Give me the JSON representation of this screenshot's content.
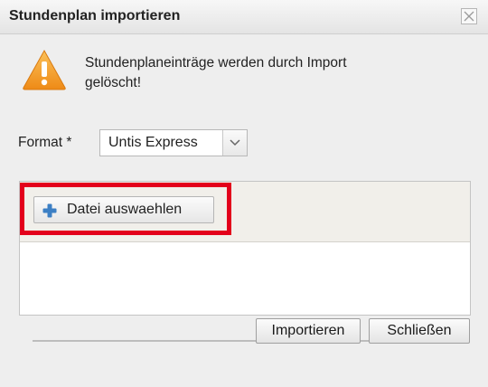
{
  "dialog": {
    "title": "Stundenplan importieren",
    "close_icon": "close-icon"
  },
  "warning": {
    "icon": "warning-triangle-icon",
    "text_line1": "Stundenplaneinträge werden durch Import",
    "text_line2": "gelöscht!"
  },
  "format": {
    "label": "Format *",
    "selected": "Untis Express",
    "arrow_icon": "chevron-down-icon"
  },
  "upload": {
    "button_label": "Datei auswaehlen",
    "button_icon": "plus-icon"
  },
  "footer": {
    "import_label": "Importieren",
    "close_label": "Schließen"
  },
  "colors": {
    "highlight": "#e3001b",
    "warning": "#f5a623",
    "plus": "#3c7fc4"
  }
}
